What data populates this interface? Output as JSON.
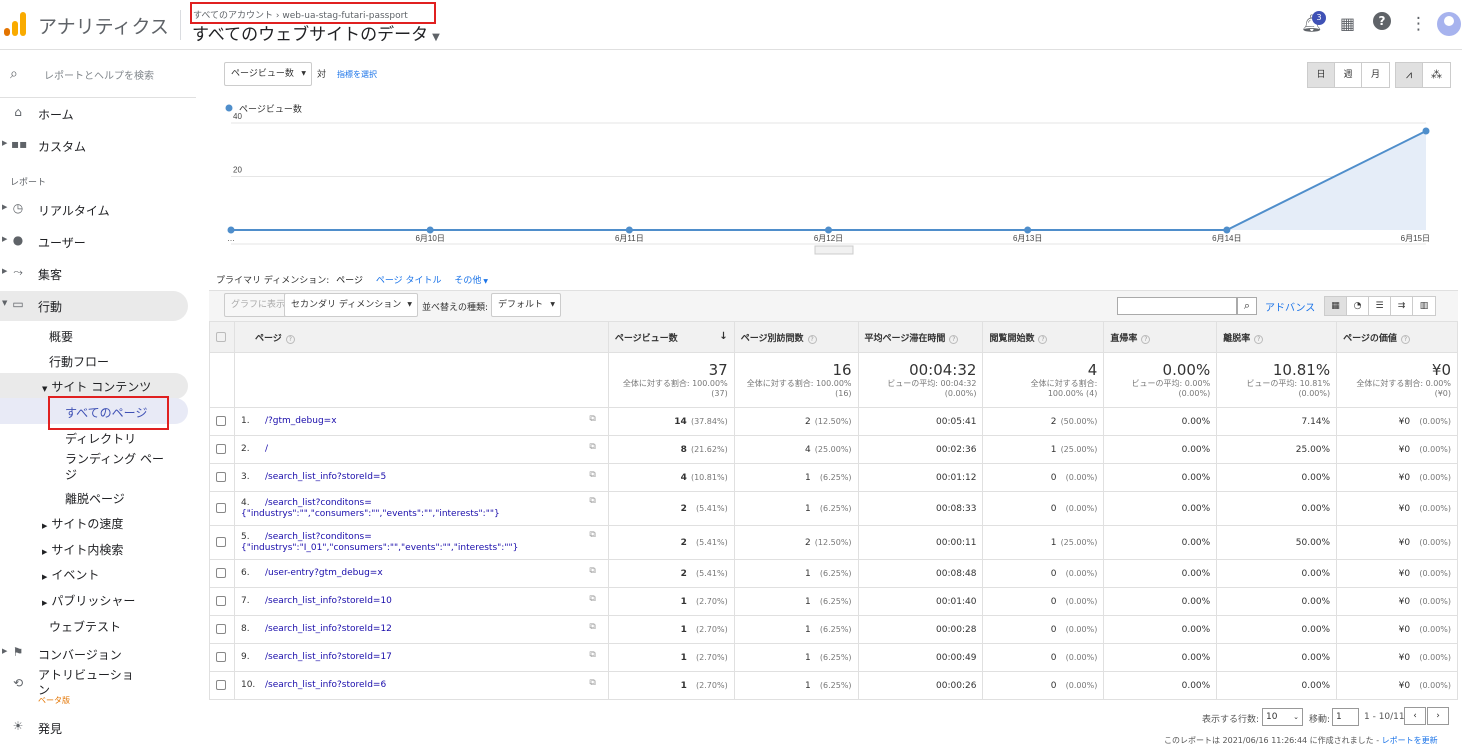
{
  "app": {
    "title": "アナリティクス",
    "breadcrumb_account": "すべてのアカウント",
    "breadcrumb_sep": "›",
    "breadcrumb_property": "web-ua-stag-futari-passport",
    "view_title": "すべてのウェブサイトのデータ",
    "notification_count": "3"
  },
  "sidebar": {
    "search_placeholder": "レポートとヘルプを検索",
    "home": "ホーム",
    "custom": "カスタム",
    "section_reports": "レポート",
    "realtime": "リアルタイム",
    "audience": "ユーザー",
    "acquisition": "集客",
    "behavior": "行動",
    "overview": "概要",
    "behavior_flow": "行動フロー",
    "site_content": "サイト コンテンツ",
    "all_pages": "すべてのページ",
    "directory": "ディレクトリ",
    "landing_1": "ランディング ペー",
    "landing_2": "ジ",
    "exit_pages": "離脱ページ",
    "site_speed": "サイトの速度",
    "site_search": "サイト内検索",
    "events": "イベント",
    "publisher": "パブリッシャー",
    "experiments": "ウェブテスト",
    "conversions": "コンバージョン",
    "attribution_1": "アトリビューショ",
    "attribution_2": "ン",
    "beta": "ベータ版",
    "discover": "発見"
  },
  "chart_controls": {
    "metric": "ページビュー数",
    "vs": "対",
    "select_metric": "指標を選択",
    "day": "日",
    "week": "週",
    "month": "月"
  },
  "chart_data": {
    "type": "area",
    "series": [
      {
        "name": "ページビュー数",
        "values": [
          0,
          0,
          0,
          0,
          0,
          0,
          37
        ]
      }
    ],
    "x": [
      "…",
      "6月10日",
      "6月11日",
      "6月12日",
      "6月13日",
      "6月14日",
      "6月15日"
    ],
    "yticks": [
      "20",
      "40"
    ],
    "ylim": [
      0,
      40
    ],
    "color": "#4f8ecb"
  },
  "dimension": {
    "label": "プライマリ ディメンション:",
    "page": "ページ",
    "page_title": "ページ タイトル",
    "other": "その他"
  },
  "toolbar": {
    "plot_rows": "グラフに表示",
    "secondary": "セカンダリ ディメンション",
    "sort_type": "並べ替えの種類:",
    "sort_default": "デフォルト",
    "advanced": "アドバンス"
  },
  "table": {
    "headers": [
      "ページ",
      "ページビュー数",
      "ページ別訪問数",
      "平均ページ滞在時間",
      "閲覧開始数",
      "直帰率",
      "離脱率",
      "ページの価値"
    ],
    "totals": [
      {
        "big": "37",
        "l1": "全体に対する割合: 100.00%",
        "l2": "(37)"
      },
      {
        "big": "16",
        "l1": "全体に対する割合: 100.00%",
        "l2": "(16)"
      },
      {
        "big": "00:04:32",
        "l1": "ビューの平均: 00:04:32",
        "l2": "(0.00%)"
      },
      {
        "big": "4",
        "l1": "全体に対する割合:",
        "l2": "100.00% (4)"
      },
      {
        "big": "0.00%",
        "l1": "ビューの平均: 0.00%",
        "l2": "(0.00%)"
      },
      {
        "big": "10.81%",
        "l1": "ビューの平均: 10.81%",
        "l2": "(0.00%)"
      },
      {
        "big": "¥0",
        "l1": "全体に対する割合: 0.00%",
        "l2": "(¥0)"
      }
    ],
    "rows": [
      {
        "n": "1.",
        "page": "/?gtm_debug=x",
        "pv": "14",
        "pvp": "(37.84%)",
        "up": "2",
        "upp": "(12.50%)",
        "t": "00:05:41",
        "en": "2",
        "enp": "(50.00%)",
        "br": "0.00%",
        "ex": "7.14%",
        "val": "¥0",
        "valp": "(0.00%)"
      },
      {
        "n": "2.",
        "page": "/",
        "pv": "8",
        "pvp": "(21.62%)",
        "up": "4",
        "upp": "(25.00%)",
        "t": "00:02:36",
        "en": "1",
        "enp": "(25.00%)",
        "br": "0.00%",
        "ex": "25.00%",
        "val": "¥0",
        "valp": "(0.00%)"
      },
      {
        "n": "3.",
        "page": "/search_list_info?storeId=5",
        "pv": "4",
        "pvp": "(10.81%)",
        "up": "1",
        "upp": "(6.25%)",
        "t": "00:01:12",
        "en": "0",
        "enp": "(0.00%)",
        "br": "0.00%",
        "ex": "0.00%",
        "val": "¥0",
        "valp": "(0.00%)"
      },
      {
        "n": "4.",
        "page": "/search_list?conditons={\"industrys\":\"\",\"consumers\":\"\",\"events\":\"\",\"interests\":\"\"}",
        "pv": "2",
        "pvp": "(5.41%)",
        "up": "1",
        "upp": "(6.25%)",
        "t": "00:08:33",
        "en": "0",
        "enp": "(0.00%)",
        "br": "0.00%",
        "ex": "0.00%",
        "val": "¥0",
        "valp": "(0.00%)"
      },
      {
        "n": "5.",
        "page": "/search_list?conditons={\"industrys\":\"I_01\",\"consumers\":\"\",\"events\":\"\",\"interests\":\"\"}",
        "pv": "2",
        "pvp": "(5.41%)",
        "up": "2",
        "upp": "(12.50%)",
        "t": "00:00:11",
        "en": "1",
        "enp": "(25.00%)",
        "br": "0.00%",
        "ex": "50.00%",
        "val": "¥0",
        "valp": "(0.00%)"
      },
      {
        "n": "6.",
        "page": "/user-entry?gtm_debug=x",
        "pv": "2",
        "pvp": "(5.41%)",
        "up": "1",
        "upp": "(6.25%)",
        "t": "00:08:48",
        "en": "0",
        "enp": "(0.00%)",
        "br": "0.00%",
        "ex": "0.00%",
        "val": "¥0",
        "valp": "(0.00%)"
      },
      {
        "n": "7.",
        "page": "/search_list_info?storeId=10",
        "pv": "1",
        "pvp": "(2.70%)",
        "up": "1",
        "upp": "(6.25%)",
        "t": "00:01:40",
        "en": "0",
        "enp": "(0.00%)",
        "br": "0.00%",
        "ex": "0.00%",
        "val": "¥0",
        "valp": "(0.00%)"
      },
      {
        "n": "8.",
        "page": "/search_list_info?storeId=12",
        "pv": "1",
        "pvp": "(2.70%)",
        "up": "1",
        "upp": "(6.25%)",
        "t": "00:00:28",
        "en": "0",
        "enp": "(0.00%)",
        "br": "0.00%",
        "ex": "0.00%",
        "val": "¥0",
        "valp": "(0.00%)"
      },
      {
        "n": "9.",
        "page": "/search_list_info?storeId=17",
        "pv": "1",
        "pvp": "(2.70%)",
        "up": "1",
        "upp": "(6.25%)",
        "t": "00:00:49",
        "en": "0",
        "enp": "(0.00%)",
        "br": "0.00%",
        "ex": "0.00%",
        "val": "¥0",
        "valp": "(0.00%)"
      },
      {
        "n": "10.",
        "page": "/search_list_info?storeId=6",
        "pv": "1",
        "pvp": "(2.70%)",
        "up": "1",
        "upp": "(6.25%)",
        "t": "00:00:26",
        "en": "0",
        "enp": "(0.00%)",
        "br": "0.00%",
        "ex": "0.00%",
        "val": "¥0",
        "valp": "(0.00%)"
      }
    ]
  },
  "pagination": {
    "rows_label": "表示する行数:",
    "rows_value": "10",
    "goto_label": "移動:",
    "goto_value": "1",
    "range": "1 - 10/11"
  },
  "footer": {
    "created": "このレポートは 2021/06/16 11:26:44 に作成されました -",
    "refresh": "レポートを更新"
  }
}
